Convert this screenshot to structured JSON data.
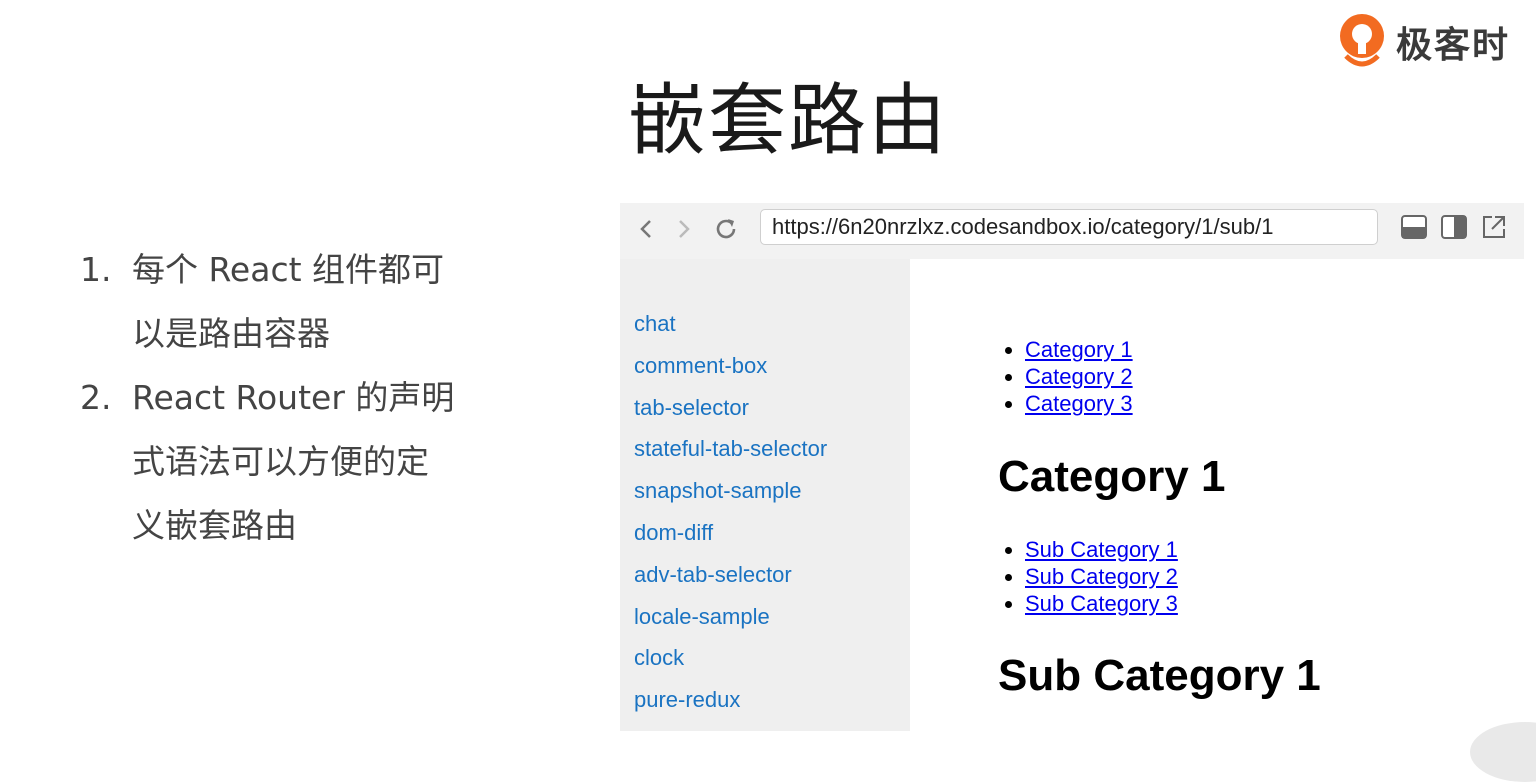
{
  "logo": {
    "text": "极客时",
    "icon": "geektime-logo"
  },
  "slide_title": "嵌套路由",
  "bullets": [
    {
      "number": "1.",
      "text": "每个 React 组件都可以是路由容器"
    },
    {
      "number": "2.",
      "text": "React Router 的声明式语法可以方便的定义嵌套路由"
    }
  ],
  "browser": {
    "url": "https://6n20nrzlxz.codesandbox.io/category/1/sub/1",
    "nav_icons": [
      "back-icon",
      "forward-icon",
      "reload-icon"
    ],
    "window_icons": [
      "dock-bottom-icon",
      "dock-side-icon",
      "open-external-icon"
    ],
    "sidebar_links": [
      "chat",
      "comment-box",
      "tab-selector",
      "stateful-tab-selector",
      "snapshot-sample",
      "dom-diff",
      "adv-tab-selector",
      "locale-sample",
      "clock",
      "pure-redux"
    ],
    "categories": [
      "Category 1",
      "Category 2",
      "Category 3"
    ],
    "category_heading": "Category 1",
    "sub_categories": [
      "Sub Category 1",
      "Sub Category 2",
      "Sub Category 3"
    ],
    "sub_category_heading": "Sub Category 1",
    "colors": {
      "sidebar_link": "#1a73c2",
      "content_link": "#0000ee",
      "logo_orange": "#f26b21"
    }
  }
}
